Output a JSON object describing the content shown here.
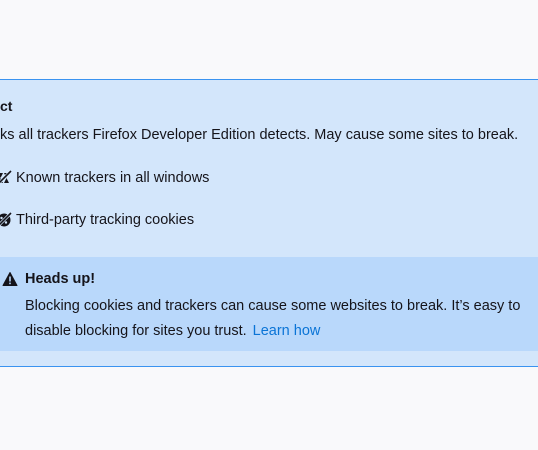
{
  "section": {
    "title": "ct",
    "description": "ks all trackers Firefox Developer Edition detects. May cause some sites to break."
  },
  "features": [
    {
      "icon": "tracker-blocked-icon",
      "label": "Known trackers in all windows"
    },
    {
      "icon": "cookie-blocked-icon",
      "label": "Third-party tracking cookies"
    }
  ],
  "warning": {
    "icon": "warning-triangle-icon",
    "title": "Heads up!",
    "body": "Blocking cookies and trackers can cause some websites to break. It’s easy to disable blocking for sites you trust.",
    "link_label": "Learn how"
  },
  "colors": {
    "panel_bg": "#d3e6fb",
    "panel_border": "#3a93f0",
    "warning_bg": "#b9d8fb",
    "link": "#0a74d6",
    "page_bg": "#f9f9fb"
  }
}
